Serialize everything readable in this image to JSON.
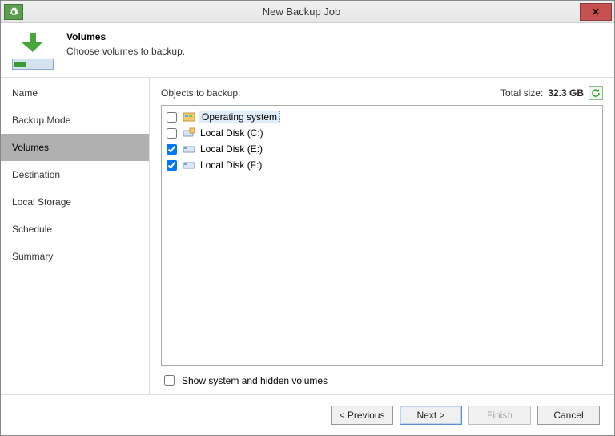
{
  "window": {
    "title": "New Backup Job"
  },
  "header": {
    "title": "Volumes",
    "subtitle": "Choose volumes to backup."
  },
  "sidebar": {
    "items": [
      {
        "label": "Name",
        "active": false
      },
      {
        "label": "Backup Mode",
        "active": false
      },
      {
        "label": "Volumes",
        "active": true
      },
      {
        "label": "Destination",
        "active": false
      },
      {
        "label": "Local Storage",
        "active": false
      },
      {
        "label": "Schedule",
        "active": false
      },
      {
        "label": "Summary",
        "active": false
      }
    ]
  },
  "main": {
    "list_label": "Objects to backup:",
    "total_label": "Total size:",
    "total_value": "32.3 GB",
    "rows": [
      {
        "label": "Operating system",
        "checked": false,
        "selected": true,
        "icon": "os"
      },
      {
        "label": "Local Disk (C:)",
        "checked": false,
        "selected": false,
        "icon": "disk-sys"
      },
      {
        "label": "Local Disk (E:)",
        "checked": true,
        "selected": false,
        "icon": "disk"
      },
      {
        "label": "Local Disk (F:)",
        "checked": true,
        "selected": false,
        "icon": "disk"
      }
    ],
    "show_hidden_label": "Show system and hidden volumes",
    "show_hidden_checked": false
  },
  "footer": {
    "previous": "< Previous",
    "next": "Next >",
    "finish": "Finish",
    "cancel": "Cancel"
  }
}
